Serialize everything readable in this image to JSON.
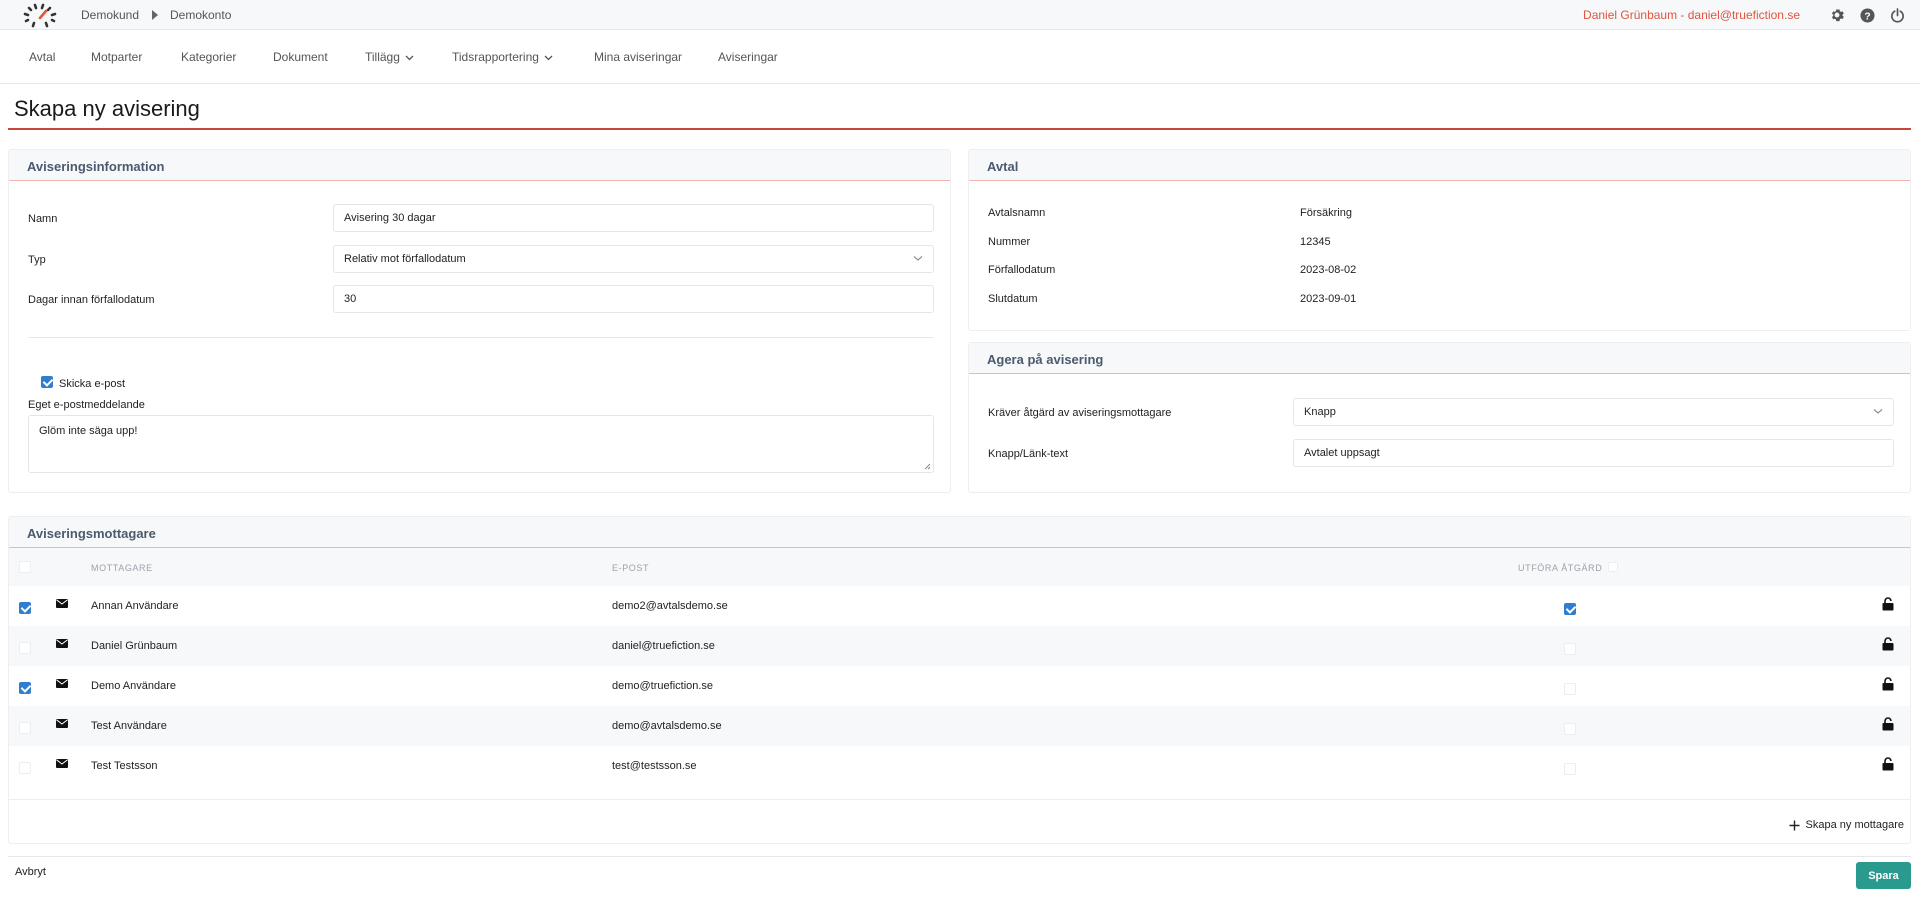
{
  "topbar": {
    "crumb_customer": "Demokund",
    "crumb_account": "Demokonto",
    "user": "Daniel Grünbaum - daniel@truefiction.se"
  },
  "nav": {
    "items": [
      "Avtal",
      "Motparter",
      "Kategorier",
      "Dokument",
      "Tillägg",
      "Tidsrapportering",
      "Mina aviseringar",
      "Aviseringar"
    ]
  },
  "page": {
    "title": "Skapa ny avisering"
  },
  "info": {
    "title": "Aviseringsinformation",
    "name_label": "Namn",
    "name_value": "Avisering 30 dagar",
    "type_label": "Typ",
    "type_value": "Relativ mot förfallodatum",
    "days_label": "Dagar innan förfallodatum",
    "days_value": "30",
    "send_email_label": "Skicka e-post",
    "send_email_checked": true,
    "custom_msg_label": "Eget e-postmeddelande",
    "custom_msg_value": "Glöm inte säga upp!"
  },
  "contract": {
    "title": "Avtal",
    "rows": [
      {
        "label": "Avtalsnamn",
        "value": "Försäkring"
      },
      {
        "label": "Nummer",
        "value": "12345"
      },
      {
        "label": "Förfallodatum",
        "value": "2023-08-02"
      },
      {
        "label": "Slutdatum",
        "value": "2023-09-01"
      }
    ]
  },
  "action": {
    "title": "Agera på avisering",
    "requires_label": "Kräver åtgärd av aviseringsmottagare",
    "requires_value": "Knapp",
    "button_text_label": "Knapp/Länk-text",
    "button_text_value": "Avtalet uppsagt"
  },
  "recipients": {
    "title": "Aviseringsmottagare",
    "col_recipient": "MOTTAGARE",
    "col_email": "E-POST",
    "col_action": "UTFÖRA ÅTGÄRD",
    "rows": [
      {
        "name": "Annan Användare",
        "email": "demo2@avtalsdemo.se",
        "selected": true,
        "action": true
      },
      {
        "name": "Daniel Grünbaum",
        "email": "daniel@truefiction.se",
        "selected": false,
        "action": false
      },
      {
        "name": "Demo Användare",
        "email": "demo@truefiction.se",
        "selected": true,
        "action": false
      },
      {
        "name": "Test Användare",
        "email": "demo@avtalsdemo.se",
        "selected": false,
        "action": false
      },
      {
        "name": "Test Testsson",
        "email": "test@testsson.se",
        "selected": false,
        "action": false
      }
    ],
    "add_label": "Skapa ny mottagare"
  },
  "footer": {
    "cancel": "Avbryt",
    "save": "Spara"
  },
  "colors": {
    "accent": "#e0553e",
    "rule": "#c9473a",
    "primary": "#2a9a8f",
    "checkbox": "#2f7fd1",
    "heading": "#4a5b6e"
  }
}
